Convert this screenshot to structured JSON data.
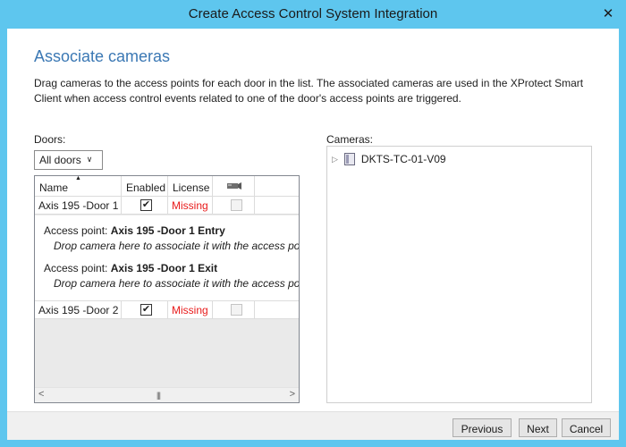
{
  "window": {
    "title": "Create Access Control System Integration"
  },
  "page": {
    "heading": "Associate cameras",
    "description": "Drag cameras to the access points for each door in the list. The associated cameras are used in the XProtect Smart Client when access control events related to one of the door's access points are triggered."
  },
  "doors": {
    "label": "Doors:",
    "filter_value": "All doors",
    "columns": {
      "name": "Name",
      "enabled": "Enabled",
      "license": "License",
      "camera_icon": "camera-icon"
    },
    "rows": [
      {
        "name": "Axis 195 -Door 1",
        "enabled": true,
        "license": "Missing"
      },
      {
        "name": "Axis 195 -Door 2",
        "enabled": true,
        "license": "Missing"
      }
    ],
    "access_points": [
      {
        "prefix": "Access point:",
        "name": "Axis 195 -Door 1 Entry",
        "hint": "Drop camera here to associate it with the access point"
      },
      {
        "prefix": "Access point:",
        "name": "Axis 195 -Door 1 Exit",
        "hint": "Drop camera here to associate it with the access point"
      }
    ]
  },
  "cameras": {
    "label": "Cameras:",
    "items": [
      {
        "name": "DKTS-TC-01-V09",
        "icon": "server-icon"
      }
    ]
  },
  "buttons": {
    "previous": "Previous",
    "next": "Next",
    "cancel": "Cancel"
  },
  "colors": {
    "title_bar": "#5ec6ee",
    "heading": "#3b78b4",
    "missing": "#e81b1b"
  }
}
